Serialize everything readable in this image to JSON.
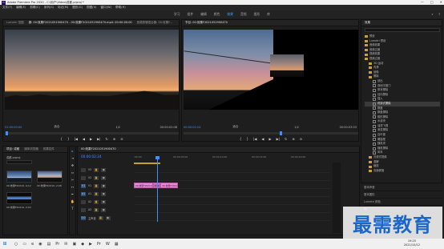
{
  "window": {
    "title": "Adobe Premiere Pro 2020 - C:\\用户\\Video\\成都.prproj *",
    "buttons": [
      "—",
      "□",
      "✕"
    ]
  },
  "menu": [
    "文件(F)",
    "编辑(E)",
    "剪辑(C)",
    "序列(S)",
    "标记(M)",
    "图形(G)",
    "视图(V)",
    "窗口(W)",
    "帮助(H)"
  ],
  "workspaces": {
    "items": [
      "学习",
      "组件",
      "编辑",
      "颜色",
      "效果",
      "音频",
      "图形",
      "库"
    ],
    "active_index": 4
  },
  "source_monitor": {
    "tabs": [
      "Lumetri 范围",
      "源: 00:效果F2021051900470 - 00:效果F2021051900470.mp4: 00:00:00:00",
      "音频剪辑混合器: 00:效果F..."
    ],
    "timecode_left": "01:00:00:00",
    "fit": "适合",
    "scale": "1/2",
    "timecode_right": "00:00:02:08",
    "scrub_fraction": 0.0,
    "buttons": [
      "{",
      "}",
      "|◀",
      "◀",
      "▶",
      "▶|",
      "↻",
      "⊕",
      "⊖"
    ]
  },
  "program_monitor": {
    "tabs": [
      "节目: 00:效果F2021051900470"
    ],
    "timecode_left": "00:00:02:24",
    "fit": "适合",
    "scale": "1/2",
    "timecode_right": "00:00:03:03",
    "scrub_fraction": 0.56,
    "buttons": [
      "{",
      "}",
      "|◀",
      "◀",
      "▶",
      "▶|",
      "↻",
      "⊕",
      "⊖"
    ]
  },
  "effects_panel": {
    "title": "效果",
    "items": [
      {
        "label": "预设",
        "kind": "folder",
        "depth": 0
      },
      {
        "label": "Lumetri 预设",
        "kind": "folder",
        "depth": 0
      },
      {
        "label": "音频效果",
        "kind": "folder",
        "depth": 0
      },
      {
        "label": "音频过渡",
        "kind": "folder",
        "depth": 0
      },
      {
        "label": "视频效果",
        "kind": "folder",
        "depth": 0
      },
      {
        "label": "视频过渡",
        "kind": "folder",
        "depth": 0
      },
      {
        "label": "3D 运动",
        "kind": "folder",
        "depth": 1
      },
      {
        "label": "内滑",
        "kind": "folder",
        "depth": 1
      },
      {
        "label": "划像",
        "kind": "folder",
        "depth": 1
      },
      {
        "label": "擦除",
        "kind": "folder",
        "depth": 1
      },
      {
        "label": "划出",
        "kind": "fx",
        "depth": 2
      },
      {
        "label": "双侧平推门",
        "kind": "fx",
        "depth": 2
      },
      {
        "label": "带状擦除",
        "kind": "fx",
        "depth": 2
      },
      {
        "label": "径向擦除",
        "kind": "fx",
        "depth": 2
      },
      {
        "label": "插入",
        "kind": "fx",
        "depth": 2
      },
      {
        "label": "时钟式擦除",
        "kind": "fx",
        "depth": 2,
        "selected": true
      },
      {
        "label": "棋盘",
        "kind": "fx",
        "depth": 2
      },
      {
        "label": "棋盘擦除",
        "kind": "fx",
        "depth": 2
      },
      {
        "label": "楔形擦除",
        "kind": "fx",
        "depth": 2
      },
      {
        "label": "水波块",
        "kind": "fx",
        "depth": 2
      },
      {
        "label": "油漆飞溅",
        "kind": "fx",
        "depth": 2
      },
      {
        "label": "渐变擦除",
        "kind": "fx",
        "depth": 2
      },
      {
        "label": "百叶窗",
        "kind": "fx",
        "depth": 2
      },
      {
        "label": "螺旋框",
        "kind": "fx",
        "depth": 2
      },
      {
        "label": "随机块",
        "kind": "fx",
        "depth": 2
      },
      {
        "label": "随机擦除",
        "kind": "fx",
        "depth": 2
      },
      {
        "label": "风车",
        "kind": "fx",
        "depth": 2
      },
      {
        "label": "沉浸式视频",
        "kind": "folder",
        "depth": 1
      },
      {
        "label": "溶解",
        "kind": "folder",
        "depth": 1
      },
      {
        "label": "缩放",
        "kind": "folder",
        "depth": 1
      },
      {
        "label": "页面剥落",
        "kind": "folder",
        "depth": 1
      }
    ],
    "side_list": [
      "基本声音",
      "基本图形",
      "Lumetri 颜色",
      "库",
      "标记",
      "历史记录"
    ]
  },
  "project_panel": {
    "tabs": [
      "项目: 成都",
      "媒体浏览器",
      "效果控件"
    ],
    "path": "成都.prproj",
    "clips": [
      {
        "label": "00:效果F20210...",
        "duration": "4:12"
      },
      {
        "label": "00:效果F20210...",
        "duration": "2:08"
      },
      {
        "label": "00:效果F20210...",
        "duration": "3:03"
      }
    ]
  },
  "tools": [
    "▸",
    "⇥",
    "✥",
    "⇔",
    "✂",
    "↔",
    "✒",
    "✋",
    "T"
  ],
  "timeline": {
    "tab": "00:效果F2021051900470",
    "timecode": "00:00:02:24",
    "ruler_labels": [
      ":00:00",
      "00:00:05:00",
      "00:00:10:00",
      "00:00:15:00",
      "00:00:20:00"
    ],
    "tracks": [
      {
        "name": "V3",
        "target": ""
      },
      {
        "name": "V2",
        "target": ""
      },
      {
        "name": "V1",
        "target": "V1"
      },
      {
        "name": "A1",
        "target": "A1"
      },
      {
        "name": "A2",
        "target": ""
      },
      {
        "name": "A3",
        "target": ""
      },
      {
        "name": "主声道",
        "target": "0.0"
      }
    ],
    "clips": [
      {
        "label": "00:效果F20210",
        "track": 2,
        "start": 0.0,
        "end": 2.4
      },
      {
        "label": "时钟式擦除",
        "track": 2,
        "start": 2.4,
        "end": 3.4
      },
      {
        "label": "00:效果F20210",
        "track": 2,
        "start": 3.4,
        "end": 5.6
      }
    ],
    "visible_seconds": 25,
    "playhead_seconds": 2.96,
    "work_area_seconds": [
      0,
      3.4
    ]
  },
  "taskbar": {
    "apps": [
      "⊞",
      "○",
      "▭",
      "e",
      "◉",
      "▤",
      "Pr",
      "✉",
      "▣",
      "◆",
      "▶",
      "Pr",
      "W",
      "▦"
    ],
    "time": "19:25",
    "date": "2021/10/12"
  },
  "watermark": "最需教育",
  "colors": {
    "accent": "#3f8fff",
    "clip": "#e48ad6",
    "work_area": "#c2a22a"
  }
}
